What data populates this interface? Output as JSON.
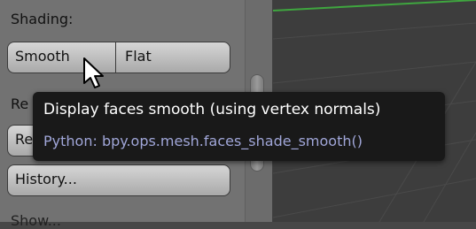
{
  "panel": {
    "shading_label": "Shading:",
    "smooth_button": "Smooth",
    "flat_button": "Flat",
    "partial_row_1": "Re",
    "partial_row_2": "Re",
    "history_button": "History...",
    "cut_off_label": "Show..."
  },
  "tooltip": {
    "description": "Display faces smooth (using vertex normals)",
    "python": "Python: bpy.ops.mesh.faces_shade_smooth()"
  },
  "colors": {
    "tooltip_python": "#a0a6d8",
    "grid_axis": "#3fa63f"
  }
}
